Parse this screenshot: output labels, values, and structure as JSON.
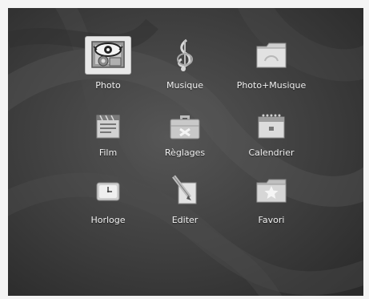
{
  "menu": {
    "items": [
      {
        "label": "Photo",
        "icon": "photo-eye-icon",
        "selected": true
      },
      {
        "label": "Musique",
        "icon": "music-clef-icon",
        "selected": false
      },
      {
        "label": "Photo+Musique",
        "icon": "folder-icon",
        "selected": false
      },
      {
        "label": "Film",
        "icon": "film-reel-icon",
        "selected": false
      },
      {
        "label": "Règlages",
        "icon": "toolbox-icon",
        "selected": false
      },
      {
        "label": "Calendrier",
        "icon": "calendar-icon",
        "selected": false
      },
      {
        "label": "Horloge",
        "icon": "clock-icon",
        "selected": false
      },
      {
        "label": "Editer",
        "icon": "pen-edit-icon",
        "selected": false
      },
      {
        "label": "Favori",
        "icon": "star-folder-icon",
        "selected": false
      }
    ]
  },
  "colors": {
    "background": "#3a3a3a",
    "label": "#f2f2f2",
    "selection": "#e8e8e8"
  }
}
